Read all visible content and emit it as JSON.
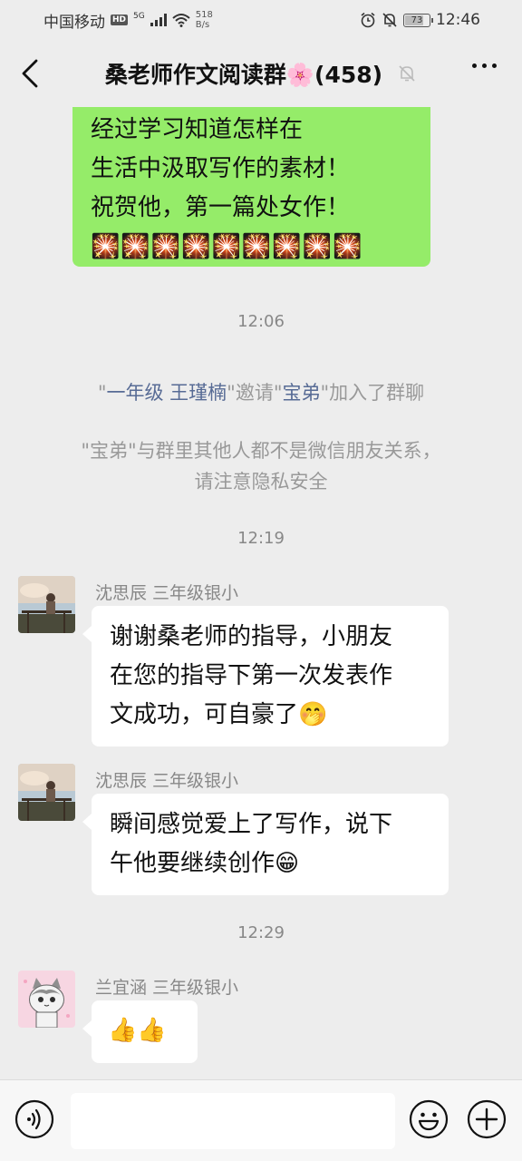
{
  "status_bar": {
    "carrier": "中国移动",
    "hd": "HD",
    "network": "5G",
    "speed_value": "518",
    "speed_unit": "B/s",
    "battery": "73",
    "time": "12:46"
  },
  "nav": {
    "title": "桑老师作文阅读群🌸(458)",
    "icons": [
      "back-icon",
      "mute-bell-icon",
      "more-icon"
    ]
  },
  "chat": {
    "top_bubble": {
      "lines": [
        "经过学习知道怎样在",
        "生活中汲取写作的素材！",
        "祝贺他，第一篇处女作！"
      ],
      "emoji_row": "🎇🎇🎇🎇🎇🎇🎇🎇🎇"
    },
    "time_1": "12:06",
    "sys_invite": {
      "q1": "\"",
      "inviter": "一年级 王瑾楠",
      "mid": "\"邀请\"",
      "invitee": "宝弟",
      "end": "\"加入了群聊"
    },
    "sys_warning": {
      "line1": "\"宝弟\"与群里其他人都不是微信朋友关系，",
      "line2": "请注意隐私安全"
    },
    "time_2": "12:19",
    "msg_1": {
      "sender": "沈思辰 三年级银小",
      "lines": [
        "谢谢桑老师的指导，小朋友",
        "在您的指导下第一次发表作",
        "文成功，可自豪了"
      ],
      "emoji": "🤭"
    },
    "msg_2": {
      "sender": "沈思辰 三年级银小",
      "lines": [
        "瞬间感觉爱上了写作，说下",
        "午他要继续创作"
      ],
      "emoji": "😁"
    },
    "time_3": "12:29",
    "msg_3": {
      "sender": "兰宜涵  三年级银小",
      "content": "👍👍"
    }
  },
  "input_bar": {
    "icons": [
      "voice-icon",
      "emoji-icon",
      "plus-icon"
    ]
  }
}
